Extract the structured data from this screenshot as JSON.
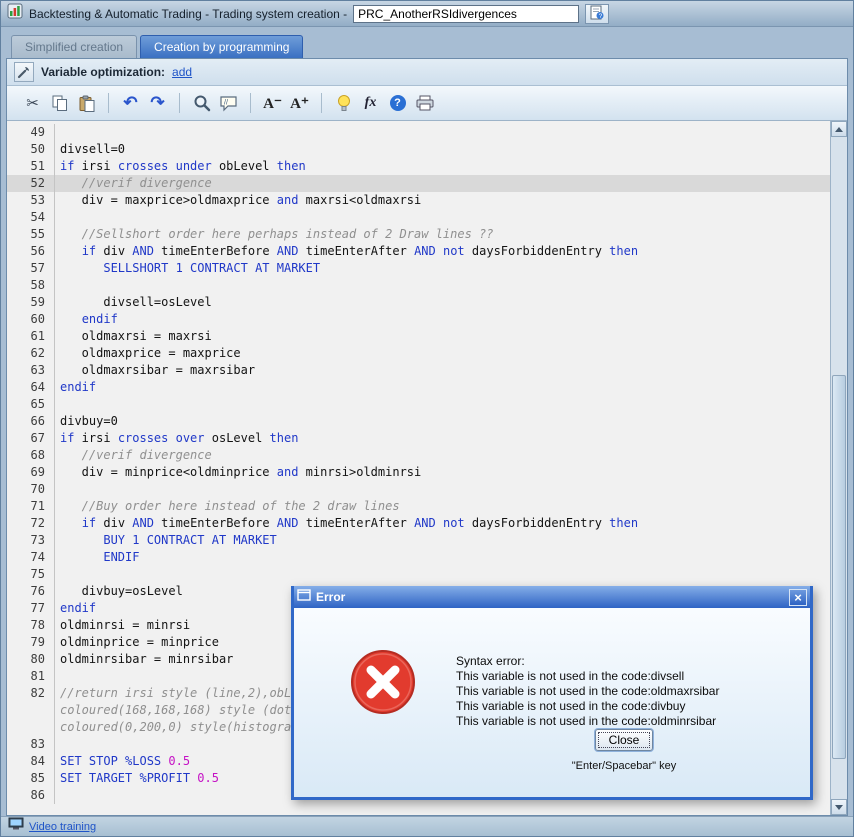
{
  "window": {
    "title": "Backtesting & Automatic Trading - Trading system creation -",
    "name_value": "PRC_AnotherRSIdivergences"
  },
  "tabs": {
    "simplified": "Simplified creation",
    "programming": "Creation by programming"
  },
  "optimization": {
    "label": "Variable optimization:",
    "add": "add"
  },
  "toolbar": {
    "cut": "✂",
    "undo": "↶",
    "redo": "↷",
    "font_decrease": "A⁻",
    "font_increase": "A⁺",
    "fx": "fx",
    "help": "?"
  },
  "editor": {
    "lines": [
      {
        "num": "49",
        "segs": []
      },
      {
        "num": "50",
        "segs": [
          [
            "p",
            "divsell=0"
          ]
        ]
      },
      {
        "num": "51",
        "segs": [
          [
            "k",
            "if"
          ],
          [
            "p",
            " irsi "
          ],
          [
            "k",
            "crosses under"
          ],
          [
            "p",
            " obLevel "
          ],
          [
            "k",
            "then"
          ]
        ]
      },
      {
        "num": "52",
        "hl": true,
        "segs": [
          [
            "c",
            "   //verif divergence"
          ]
        ]
      },
      {
        "num": "53",
        "segs": [
          [
            "p",
            "   div = maxprice>oldmaxprice "
          ],
          [
            "k",
            "and"
          ],
          [
            "p",
            " maxrsi<oldmaxrsi"
          ]
        ]
      },
      {
        "num": "54",
        "segs": []
      },
      {
        "num": "55",
        "segs": [
          [
            "c",
            "   //Sellshort order here perhaps instead of 2 Draw lines ??"
          ]
        ]
      },
      {
        "num": "56",
        "segs": [
          [
            "p",
            "   "
          ],
          [
            "k",
            "if"
          ],
          [
            "p",
            " div "
          ],
          [
            "k",
            "AND"
          ],
          [
            "p",
            " timeEnterBefore "
          ],
          [
            "k",
            "AND"
          ],
          [
            "p",
            " timeEnterAfter "
          ],
          [
            "k",
            "AND"
          ],
          [
            "p",
            " "
          ],
          [
            "k",
            "not"
          ],
          [
            "p",
            " daysForbiddenEntry "
          ],
          [
            "k",
            "then"
          ]
        ]
      },
      {
        "num": "57",
        "segs": [
          [
            "p",
            "      "
          ],
          [
            "k",
            "SELLSHORT 1 CONTRACT AT MARKET"
          ]
        ]
      },
      {
        "num": "58",
        "segs": []
      },
      {
        "num": "59",
        "segs": [
          [
            "p",
            "      divsell=osLevel"
          ]
        ]
      },
      {
        "num": "60",
        "segs": [
          [
            "p",
            "   "
          ],
          [
            "k",
            "endif"
          ]
        ]
      },
      {
        "num": "61",
        "segs": [
          [
            "p",
            "   oldmaxrsi = maxrsi"
          ]
        ]
      },
      {
        "num": "62",
        "segs": [
          [
            "p",
            "   oldmaxprice = maxprice"
          ]
        ]
      },
      {
        "num": "63",
        "segs": [
          [
            "p",
            "   oldmaxrsibar = maxrsibar"
          ]
        ]
      },
      {
        "num": "64",
        "segs": [
          [
            "k",
            "endif"
          ]
        ]
      },
      {
        "num": "65",
        "segs": []
      },
      {
        "num": "66",
        "segs": [
          [
            "p",
            "divbuy=0"
          ]
        ]
      },
      {
        "num": "67",
        "segs": [
          [
            "k",
            "if"
          ],
          [
            "p",
            " irsi "
          ],
          [
            "k",
            "crosses over"
          ],
          [
            "p",
            " osLevel "
          ],
          [
            "k",
            "then"
          ]
        ]
      },
      {
        "num": "68",
        "segs": [
          [
            "c",
            "   //verif divergence"
          ]
        ]
      },
      {
        "num": "69",
        "segs": [
          [
            "p",
            "   div = minprice<oldminprice "
          ],
          [
            "k",
            "and"
          ],
          [
            "p",
            " minrsi>oldminrsi"
          ]
        ]
      },
      {
        "num": "70",
        "segs": []
      },
      {
        "num": "71",
        "segs": [
          [
            "c",
            "   //Buy order here instead of the 2 draw lines"
          ]
        ]
      },
      {
        "num": "72",
        "segs": [
          [
            "p",
            "   "
          ],
          [
            "k",
            "if"
          ],
          [
            "p",
            " div "
          ],
          [
            "k",
            "AND"
          ],
          [
            "p",
            " timeEnterBefore "
          ],
          [
            "k",
            "AND"
          ],
          [
            "p",
            " timeEnterAfter "
          ],
          [
            "k",
            "AND"
          ],
          [
            "p",
            " "
          ],
          [
            "k",
            "not"
          ],
          [
            "p",
            " daysForbiddenEntry "
          ],
          [
            "k",
            "then"
          ]
        ]
      },
      {
        "num": "73",
        "segs": [
          [
            "p",
            "      "
          ],
          [
            "k",
            "BUY 1 CONTRACT AT MARKET"
          ]
        ]
      },
      {
        "num": "74",
        "segs": [
          [
            "p",
            "      "
          ],
          [
            "k",
            "ENDIF"
          ]
        ]
      },
      {
        "num": "75",
        "segs": []
      },
      {
        "num": "76",
        "segs": [
          [
            "p",
            "   divbuy=osLevel"
          ]
        ]
      },
      {
        "num": "77",
        "segs": [
          [
            "k",
            "endif"
          ]
        ]
      },
      {
        "num": "78",
        "segs": [
          [
            "p",
            "oldminrsi = minrsi"
          ]
        ]
      },
      {
        "num": "79",
        "segs": [
          [
            "p",
            "oldminprice = minprice"
          ]
        ]
      },
      {
        "num": "80",
        "segs": [
          [
            "p",
            "oldminrsibar = minrsibar"
          ]
        ]
      },
      {
        "num": "81",
        "segs": []
      },
      {
        "num": "82",
        "segs": [
          [
            "c",
            "//return irsi style (line,2),obLev"
          ]
        ]
      },
      {
        "num": "",
        "segs": [
          [
            "c",
            "coloured(168,168,168) style (dott"
          ]
        ]
      },
      {
        "num": "",
        "segs": [
          [
            "c",
            "coloured(0,200,0) style(histogram"
          ]
        ]
      },
      {
        "num": "83",
        "segs": []
      },
      {
        "num": "84",
        "segs": [
          [
            "k",
            "SET STOP %LOSS"
          ],
          [
            "p",
            " "
          ],
          [
            "n",
            "0.5"
          ]
        ]
      },
      {
        "num": "85",
        "segs": [
          [
            "k",
            "SET TARGET %PROFIT"
          ],
          [
            "p",
            " "
          ],
          [
            "n",
            "0.5"
          ]
        ]
      },
      {
        "num": "86",
        "segs": []
      }
    ]
  },
  "dialog": {
    "title": "Error",
    "close_x": "×",
    "messages": [
      "Syntax error:",
      "This variable is not used in the code:divsell",
      "This variable is not used in the code:oldmaxrsibar",
      "This variable is not used in the code:divbuy",
      "This variable is not used in the code:oldminrsibar"
    ],
    "close": "Close",
    "hint": "\"Enter/Spacebar\" key"
  },
  "statusbar": {
    "video": "Video training"
  },
  "colors": {
    "tab_active": "#3a70c2",
    "keyword_blue": "#2038c8",
    "comment_gray": "#8f8f8f",
    "number_magenta": "#c513c5",
    "dialog_titlebar": "#2e63c4",
    "error_red": "#e23b2e",
    "link_blue": "#1f54c8"
  }
}
